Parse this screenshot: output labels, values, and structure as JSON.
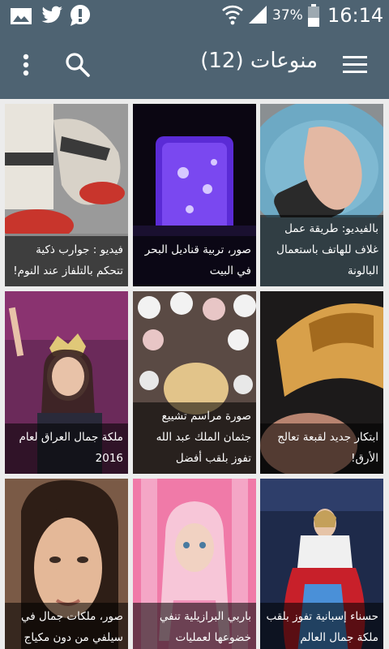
{
  "status_bar": {
    "battery": "37%",
    "time": "16:14",
    "icons": [
      "image-icon",
      "twitter-icon",
      "alert-icon",
      "wifi-icon",
      "signal-icon",
      "battery-icon"
    ]
  },
  "app_bar": {
    "title": "منوعات (12)",
    "icons": [
      "menu-icon",
      "search-icon",
      "more-vert-icon"
    ]
  },
  "articles": [
    {
      "caption": "بالفيديو: طريقة عمل غلاف للهاتف باستعمال البالونة"
    },
    {
      "caption": "صور، تربية قناديل البحر في البيت"
    },
    {
      "caption": "فيديو : جوارب ذكية تتحكم بالتلفاز عند النوم!"
    },
    {
      "caption": "ابتكار جديد لقبعة تعالج الأرق!"
    },
    {
      "caption": "صورة مراسم تشييع جثمان الملك عبد الله تفوز بلقب أفضل"
    },
    {
      "caption": "ملكة جمال العراق لعام 2016"
    },
    {
      "caption": "حسناء إسبانية تفوز بلقب ملكة جمال العالم"
    },
    {
      "caption": "باربي البرازيلية تنفي خضوعها لعمليات"
    },
    {
      "caption": "صور، ملكات جمال في سيلفي من دون مكياج"
    }
  ]
}
